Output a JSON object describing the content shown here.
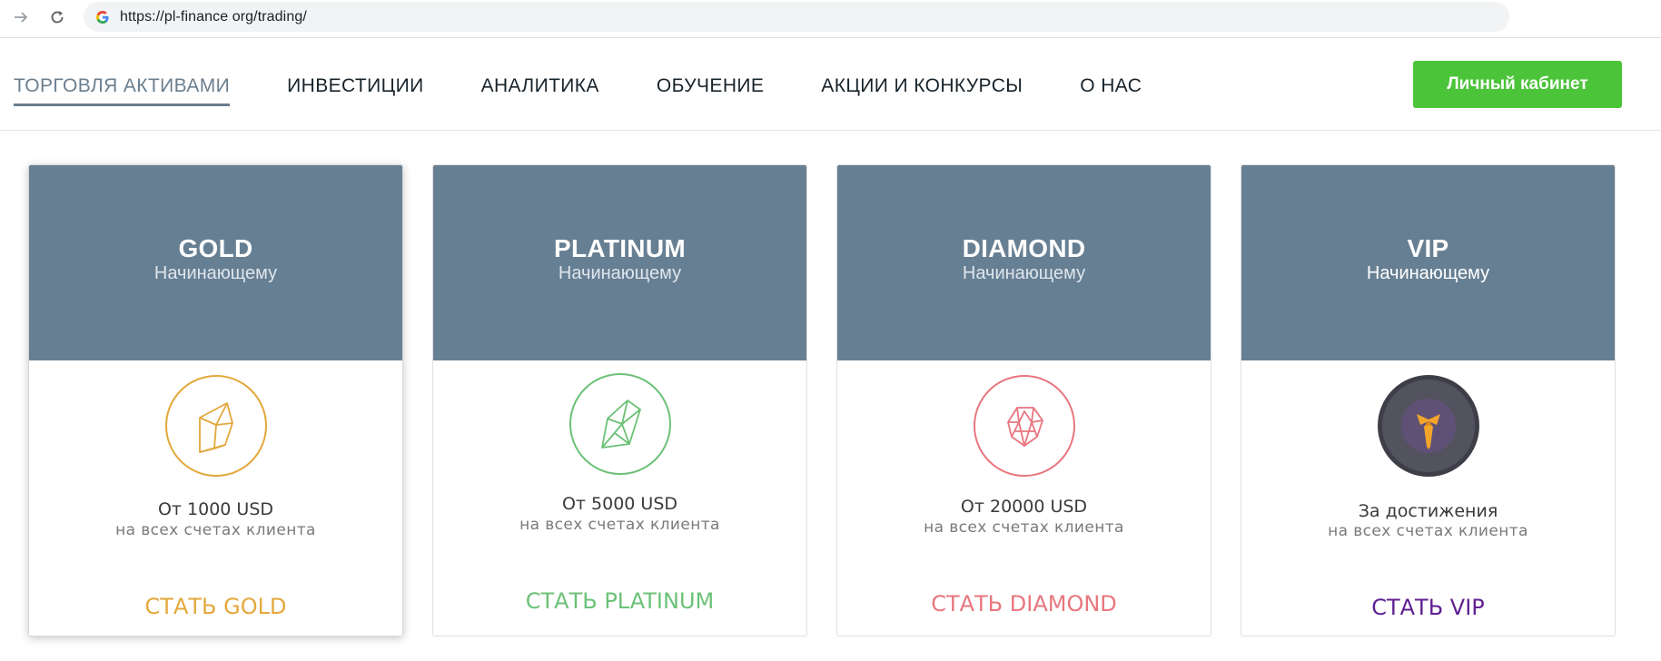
{
  "browser": {
    "url": "https://pl-finance org/trading/"
  },
  "menu": {
    "items": [
      {
        "label": "ТОРГОВЛЯ АКТИВАМИ",
        "active": true
      },
      {
        "label": "ИНВЕСТИЦИИ"
      },
      {
        "label": "АНАЛИТИКА"
      },
      {
        "label": "ОБУЧЕНИЕ"
      },
      {
        "label": "АКЦИИ И КОНКУРСЫ"
      },
      {
        "label": "О НАС"
      }
    ],
    "cabinet_label": "Личный кабинет"
  },
  "colors": {
    "header_bg": "#677f93",
    "gold": "#e3a83b",
    "platinum": "#6cc177",
    "diamond": "#e8767e",
    "vip": "#5f1f91",
    "cabinet": "#4cc43a"
  },
  "cards": [
    {
      "title": "GOLD",
      "subtitle": "Начинающему",
      "icon": "gold-crystal-icon",
      "price": "От 1000 USD",
      "note": "на всех счетах клиента",
      "cta": "СТАТЬ GOLD"
    },
    {
      "title": "PLATINUM",
      "subtitle": "Начинающему",
      "icon": "platinum-crystal-icon",
      "price": "От 5000 USD",
      "note": "на всех счетах клиента",
      "cta": "СТАТЬ PLATINUM"
    },
    {
      "title": "DIAMOND",
      "subtitle": "Начинающему",
      "icon": "diamond-icon",
      "price": "От 20000 USD",
      "note": "на всех счетах клиента",
      "cta": "СТАТЬ DIAMOND"
    },
    {
      "title": "VIP",
      "subtitle": "Начинающему",
      "icon": "tie-icon",
      "price": "За достижения",
      "note": "на всех счетах клиента",
      "cta": "СТАТЬ VIP"
    }
  ]
}
